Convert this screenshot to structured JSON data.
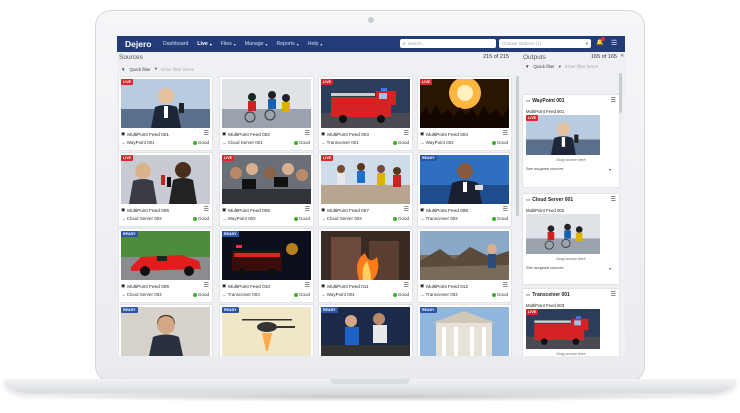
{
  "app": {
    "logo": "Dejero"
  },
  "nav": {
    "items": [
      {
        "label": "Dashboard",
        "caret": ""
      },
      {
        "label": "Live",
        "caret": "▾"
      },
      {
        "label": "Files",
        "caret": "▾"
      },
      {
        "label": "Manage",
        "caret": "▾"
      },
      {
        "label": "Reports",
        "caret": "▾"
      },
      {
        "label": "Help",
        "caret": "▾"
      }
    ],
    "search_placeholder": "Search...",
    "station_placeholder": "Choose stations (1)"
  },
  "sources": {
    "title": "Sources",
    "count": "215 of 215",
    "quick_filter": "Quick filter",
    "filter_placeholder": "Enter filter terms",
    "cards": [
      {
        "name": "MultiPoint Feed 001",
        "dest": "→ WayPoint 001",
        "status": "Good",
        "tag": "LIVE",
        "scene": "speaker"
      },
      {
        "name": "MultiPoint Feed 002",
        "dest": "→ Cloud Server 001",
        "status": "Good",
        "tag": "",
        "scene": "cyclists"
      },
      {
        "name": "MultiPoint Feed 003",
        "dest": "→ Transceiver 001",
        "status": "Good",
        "tag": "LIVE",
        "scene": "firetruck"
      },
      {
        "name": "MultiPoint Feed 004",
        "dest": "→ WayPoint 002",
        "status": "Good",
        "tag": "LIVE",
        "scene": "concert"
      },
      {
        "name": "MultiPoint Feed 005",
        "dest": "→ Cloud Server 002",
        "status": "Good",
        "tag": "LIVE",
        "scene": "interview"
      },
      {
        "name": "MultiPoint Feed 006",
        "dest": "→ WayPoint 003",
        "status": "Good",
        "tag": "LIVE",
        "scene": "press"
      },
      {
        "name": "MultiPoint Feed 007",
        "dest": "→ Cloud Server 003",
        "status": "Good",
        "tag": "LIVE",
        "scene": "runners"
      },
      {
        "name": "MultiPoint Feed 008",
        "dest": "→ Transceiver 002",
        "status": "Good",
        "tag": "READY",
        "scene": "anchor"
      },
      {
        "name": "MultiPoint Feed 009",
        "dest": "→ Cloud Server 004",
        "status": "Good",
        "tag": "READY",
        "scene": "racecar"
      },
      {
        "name": "MultiPoint Feed 010",
        "dest": "→ Transceiver 003",
        "status": "Good",
        "tag": "READY",
        "scene": "nightfire"
      },
      {
        "name": "MultiPoint Feed 011",
        "dest": "→ WayPoint 004",
        "status": "Good",
        "tag": "",
        "scene": "blaze"
      },
      {
        "name": "MultiPoint Feed 012",
        "dest": "→ Transceiver 004",
        "status": "Good",
        "tag": "",
        "scene": "rubble"
      },
      {
        "name": "",
        "dest": "",
        "status": "",
        "tag": "READY",
        "scene": "reporter"
      },
      {
        "name": "",
        "dest": "",
        "status": "",
        "tag": "READY",
        "scene": "helicopter"
      },
      {
        "name": "",
        "dest": "",
        "status": "",
        "tag": "READY",
        "scene": "cycling"
      },
      {
        "name": "",
        "dest": "",
        "status": "",
        "tag": "READY",
        "scene": "building"
      }
    ]
  },
  "outputs": {
    "title": "Outputs",
    "count": "165 of 165",
    "collapse": "«",
    "quick_filter": "Quick filter",
    "filter_placeholder": "Enter filter terms",
    "cards": [
      {
        "name": "WayPoint 001",
        "source": "MultiPoint Feed 001",
        "tag": "LIVE",
        "scene": "speaker",
        "drag": "Drag source here",
        "assign": "See assigned sources"
      },
      {
        "name": "Cloud Server 001",
        "source": "MultiPoint Feed 002",
        "tag": "",
        "scene": "cyclists",
        "drag": "Drag source here",
        "assign": "See assigned sources"
      },
      {
        "name": "Transceiver 001",
        "source": "MultiPoint Feed 003",
        "tag": "LIVE",
        "scene": "firetruck",
        "drag": "Drag source here",
        "assign": "See assigned sources"
      }
    ]
  },
  "colors": {
    "nav": "#243b7a",
    "live": "#e0262c",
    "ready": "#2b56a8",
    "good": "#3fae2a"
  }
}
